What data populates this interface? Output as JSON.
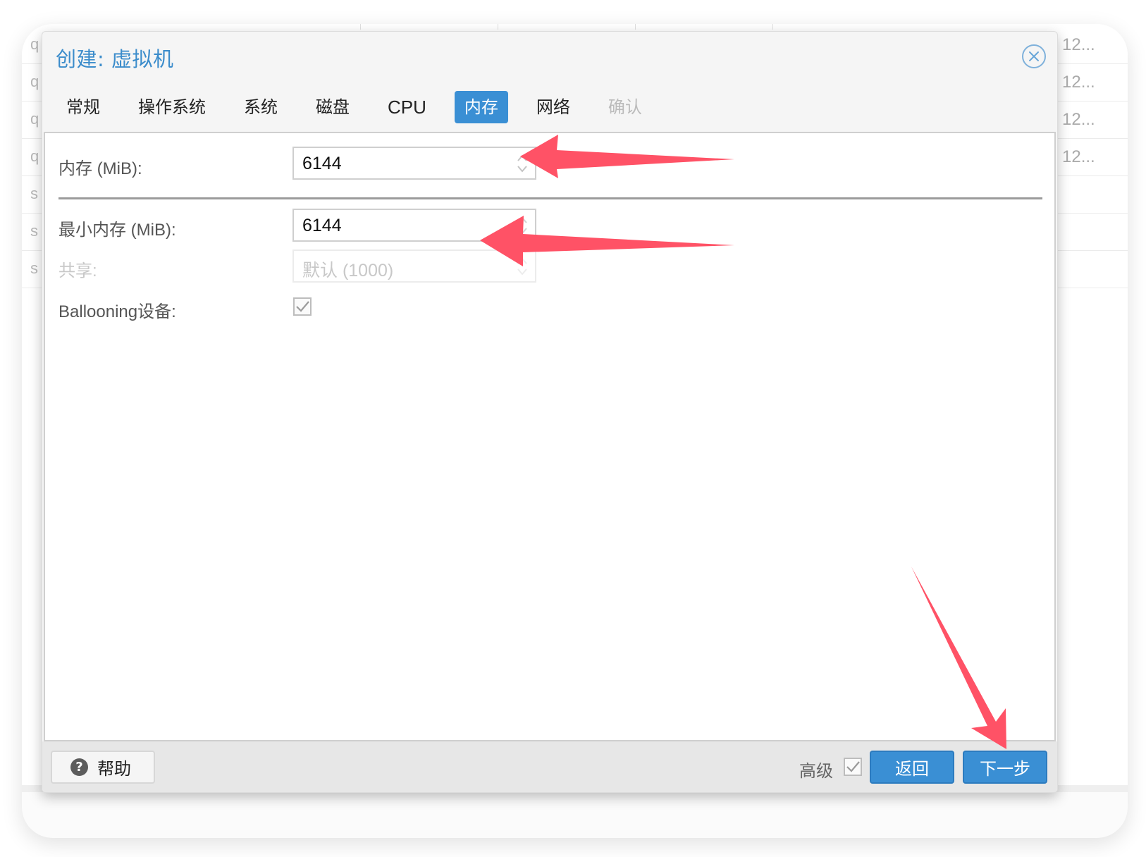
{
  "background_table": {
    "rows": [
      {
        "left": "q",
        "right": "12..."
      },
      {
        "left": "q",
        "right": "12..."
      },
      {
        "left": "q",
        "right": "12..."
      },
      {
        "left": "q",
        "right": "12..."
      },
      {
        "left": "s",
        "right": ""
      },
      {
        "left": "s",
        "right": ""
      },
      {
        "left": "s",
        "right": ""
      }
    ]
  },
  "dialog": {
    "title": "创建: 虚拟机",
    "close_icon": "close-circle-icon",
    "tabs": [
      {
        "label": "常规",
        "state": "normal"
      },
      {
        "label": "操作系统",
        "state": "normal"
      },
      {
        "label": "系统",
        "state": "normal"
      },
      {
        "label": "磁盘",
        "state": "normal"
      },
      {
        "label": "CPU",
        "state": "normal"
      },
      {
        "label": "内存",
        "state": "active"
      },
      {
        "label": "网络",
        "state": "normal"
      },
      {
        "label": "确认",
        "state": "disabled"
      }
    ],
    "form": {
      "memory": {
        "label": "内存 (MiB):",
        "value": "6144"
      },
      "min_memory": {
        "label": "最小内存 (MiB):",
        "value": "6144"
      },
      "shares": {
        "label": "共享:",
        "placeholder": "默认 (1000)",
        "disabled": true
      },
      "ballooning": {
        "label": "Ballooning设备:",
        "checked": true
      }
    },
    "footer": {
      "help_label": "帮助",
      "help_icon": "question-circle-icon",
      "advanced_label": "高级",
      "advanced_checked": true,
      "back_label": "返回",
      "next_label": "下一步"
    }
  },
  "annotations": {
    "arrow_color": "#ff5266",
    "arrows": [
      "points-to-memory-field",
      "points-to-min-memory-field",
      "points-to-next-button"
    ]
  },
  "colors": {
    "accent": "#3a8fd4",
    "title": "#3b8ccb"
  }
}
